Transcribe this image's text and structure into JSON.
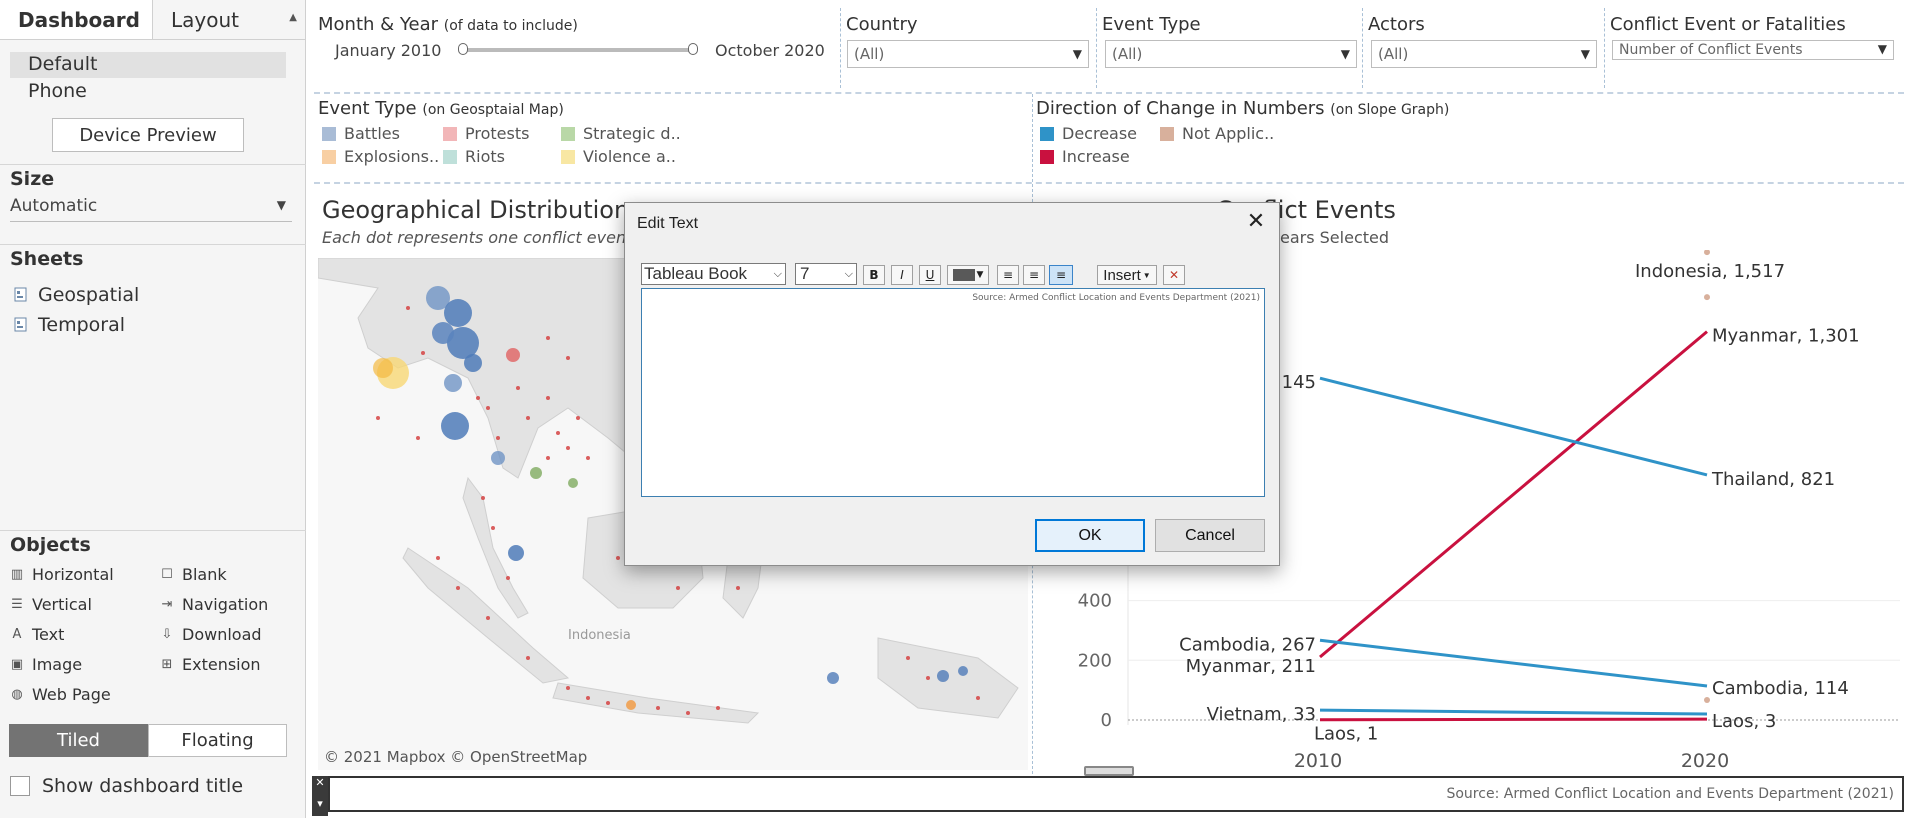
{
  "left_panel": {
    "tabs": [
      "Dashboard",
      "Layout"
    ],
    "devices": [
      "Default",
      "Phone"
    ],
    "device_preview": "Device Preview",
    "size_title": "Size",
    "size_value": "Automatic",
    "sheets_title": "Sheets",
    "sheets": [
      "Geospatial",
      "Temporal"
    ],
    "objects_title": "Objects",
    "objects_left": [
      "Horizontal",
      "Vertical",
      "Text",
      "Image",
      "Web Page"
    ],
    "objects_right": [
      "Blank",
      "Navigation",
      "Download",
      "Extension"
    ],
    "tiled": "Tiled",
    "floating": "Floating",
    "show_title": "Show dashboard title"
  },
  "filters": {
    "date_label": "Month & Year",
    "date_hint": "(of data to include)",
    "date_start": "January 2010",
    "date_end": "October 2020",
    "country_label": "Country",
    "country_value": "(All)",
    "event_type_label": "Event Type",
    "event_type_value": "(All)",
    "actors_label": "Actors",
    "actors_value": "(All)",
    "conflict_label": "Conflict Event or Fatalities",
    "conflict_value": "Number of Conflict Events"
  },
  "legends": {
    "event_title": "Event Type",
    "event_hint": "(on Geosptaial Map)",
    "event_items": [
      {
        "label": "Battles",
        "color": "#a9bcd6"
      },
      {
        "label": "Protests",
        "color": "#f2b6b8"
      },
      {
        "label": "Strategic d..",
        "color": "#b9d8a7"
      },
      {
        "label": "Explosions..",
        "color": "#f8cfa3"
      },
      {
        "label": "Riots",
        "color": "#bfe0da"
      },
      {
        "label": "Violence a..",
        "color": "#f8e7a3"
      }
    ],
    "direction_title": "Direction of Change in Numbers",
    "direction_hint": "(on Slope Graph)",
    "direction_items": [
      {
        "label": "Decrease",
        "color": "#2f93c8"
      },
      {
        "label": "Not Applic..",
        "color": "#d8b09c"
      },
      {
        "label": "Increase",
        "color": "#c9113f"
      }
    ]
  },
  "map": {
    "title": "Geographical Distribution o",
    "subtitle": "Each dot represents one conflict event, s",
    "place_label": "Indonesia",
    "attribution": "© 2021 Mapbox © OpenStreetMap"
  },
  "slope": {
    "title": "Conflict Events",
    "subtitle": "ears Selected"
  },
  "dialog": {
    "title": "Edit Text",
    "font": "Tableau Book",
    "size": "7",
    "insert": "Insert",
    "content": "Source: Armed Conflict Location and Events Department (2021)",
    "ok": "OK",
    "cancel": "Cancel"
  },
  "footer": {
    "source": "Source: Armed Conflict Location and Events Department (2021)"
  },
  "chart_data": {
    "type": "line",
    "x": [
      "2010",
      "2020"
    ],
    "yticks": [
      0,
      200,
      400
    ],
    "series": [
      {
        "name": "Indonesia",
        "values": [
          null,
          1517
        ],
        "direction": "Not Applic..",
        "color": "#d8b09c"
      },
      {
        "name": "Myanmar",
        "values": [
          211,
          1301
        ],
        "direction": "Increase",
        "color": "#c9113f"
      },
      {
        "name": "Thailand",
        "values": [
          1145,
          821
        ],
        "direction": "Decrease",
        "color": "#2f93c8"
      },
      {
        "name": "Cambodia",
        "values": [
          267,
          114
        ],
        "direction": "Decrease",
        "color": "#2f93c8"
      },
      {
        "name": "Vietnam",
        "values": [
          33,
          null
        ],
        "direction": "Decrease",
        "color": "#2f93c8"
      },
      {
        "name": "Laos",
        "values": [
          1,
          3
        ],
        "direction": "Increase",
        "color": "#c9113f"
      }
    ],
    "labels": {
      "indonesia_2020": "Indonesia, 1,517",
      "myanmar_2020": "Myanmar, 1,301",
      "thailand_2010_partial": "145",
      "thailand_2020": "Thailand, 821",
      "cambodia_2010": "Cambodia, 267",
      "myanmar_2010": "Myanmar, 211",
      "vietnam_2010": "Vietnam, 33",
      "laos_2010": "Laos, 1",
      "cambodia_2020": "Cambodia, 114",
      "laos_2020": "Laos, 3"
    }
  }
}
